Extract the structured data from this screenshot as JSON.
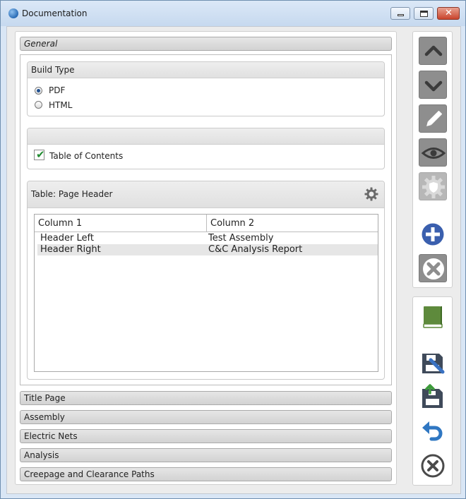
{
  "window": {
    "title": "Documentation",
    "close_glyph": "✕"
  },
  "sections": {
    "general": "General",
    "collapsed": [
      "Title Page",
      "Assembly",
      "Electric Nets",
      "Analysis",
      "Creepage and Clearance Paths"
    ]
  },
  "build_type": {
    "title": "Build Type",
    "options": [
      {
        "label": "PDF",
        "selected": true
      },
      {
        "label": "HTML",
        "selected": false
      }
    ]
  },
  "toc": {
    "title": "",
    "label": "Table of Contents",
    "checked": true,
    "check_glyph": "✔"
  },
  "page_header": {
    "title": "Table: Page Header",
    "columns": [
      "Column 1",
      "Column 2"
    ],
    "rows": [
      [
        "Header Left",
        "Test Assembly"
      ],
      [
        "Header Right",
        "C&C Analysis Report"
      ]
    ]
  },
  "toolbar": {
    "icons": [
      "chevron-up-icon",
      "chevron-down-icon",
      "pencil-icon",
      "eye-icon",
      "shield-gear-icon",
      "plus-circle-icon",
      "x-circle-icon",
      "book-icon",
      "save-edit-icon",
      "save-upload-icon",
      "undo-icon",
      "close-circle-icon"
    ],
    "colors": {
      "grey": "#8e8e8e",
      "blue": "#3a5fae",
      "green": "#5e8a3c",
      "undo": "#2f77c2"
    }
  }
}
